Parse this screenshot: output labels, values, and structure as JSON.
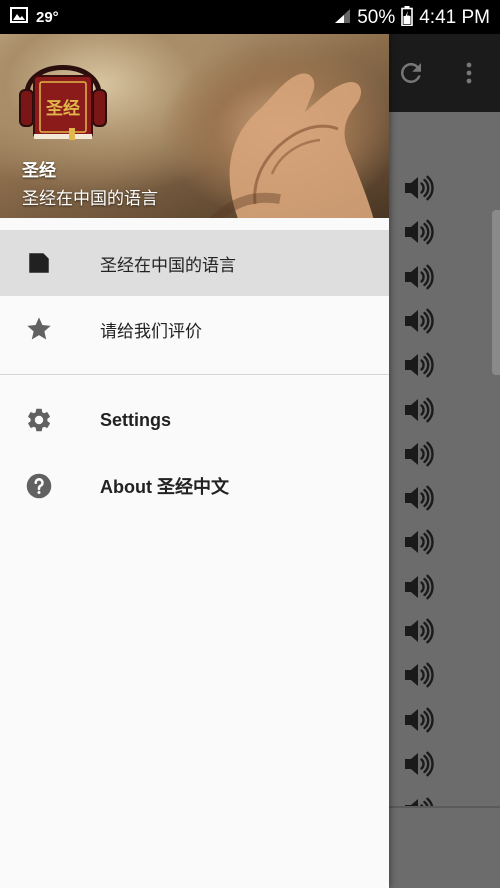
{
  "status_bar": {
    "temperature": "29°",
    "battery_percent": "50%",
    "time": "4:41 PM"
  },
  "app_toolbar": {
    "actions": [
      "refresh-icon",
      "more-vert-icon"
    ]
  },
  "audio_list": {
    "item_icon": "speaker-icon",
    "visible_items": 14
  },
  "drawer": {
    "header": {
      "logo_text": "圣经",
      "title": "圣经",
      "subtitle": "圣经在中国的语言"
    },
    "primary_items": [
      {
        "label": "圣经在中国的语言",
        "icon": "document-icon",
        "active": true
      },
      {
        "label": "请给我们评价",
        "icon": "star-icon",
        "active": false
      }
    ],
    "secondary_items": [
      {
        "label": "Settings",
        "icon": "gear-icon"
      },
      {
        "label": "About 圣经中文",
        "icon": "help-icon"
      }
    ]
  },
  "colors": {
    "drawer_bg": "#fafafa",
    "active_item_bg": "#dedede",
    "icon_gray": "#616161",
    "toolbar_bg": "#1b1b1b",
    "scrim": "#6c6c6c",
    "logo_red": "#8b1a1a",
    "logo_gold": "#e1b64a"
  }
}
